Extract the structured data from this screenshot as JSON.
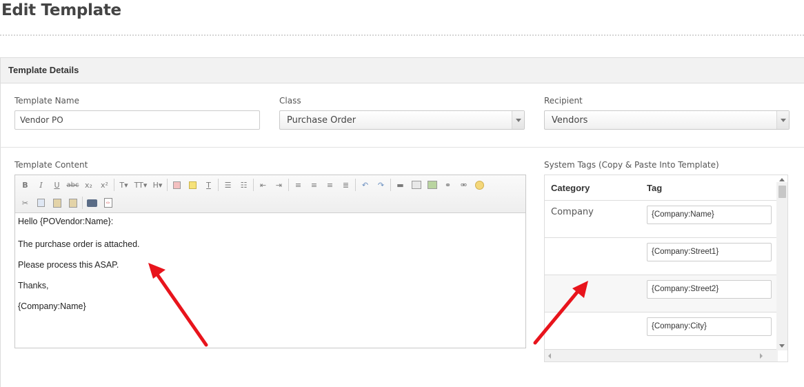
{
  "page": {
    "title": "Edit Template"
  },
  "panel": {
    "header": "Template Details"
  },
  "fields": {
    "template_name": {
      "label": "Template Name",
      "value": "Vendor PO"
    },
    "class": {
      "label": "Class",
      "value": "Purchase Order"
    },
    "recipient": {
      "label": "Recipient",
      "value": "Vendors"
    }
  },
  "editor": {
    "label": "Template Content",
    "toolbar": {
      "row1": [
        "B",
        "I",
        "U",
        "abc",
        "x₂",
        "x²",
        "T▾",
        "TT▾",
        "H▾"
      ],
      "icons": [
        "bold-icon",
        "italic-icon",
        "underline-icon",
        "strikethrough-icon",
        "subscript-icon",
        "superscript-icon",
        "font-icon",
        "font-size-icon",
        "heading-icon",
        "clear-format-icon",
        "highlight-icon",
        "remove-format-icon",
        "bullet-list-icon",
        "numbered-list-icon",
        "outdent-icon",
        "indent-icon",
        "align-left-icon",
        "align-center-icon",
        "align-right-icon",
        "justify-icon",
        "undo-icon",
        "redo-icon",
        "horizontal-rule-icon",
        "table-icon",
        "image-icon",
        "link-icon",
        "unlink-icon",
        "emoji-icon",
        "cut-icon",
        "copy-icon",
        "paste-icon",
        "paste-text-icon",
        "print-icon",
        "source-icon"
      ]
    },
    "content": [
      "Hello {POVendor:Name}:",
      "The purchase order is attached.",
      "Please process this ASAP.",
      "Thanks,",
      "{Company:Name}"
    ]
  },
  "tags": {
    "label": "System Tags (Copy & Paste Into Template)",
    "headers": {
      "category": "Category",
      "tag": "Tag"
    },
    "rows": [
      {
        "category": "Company",
        "tag": "{Company:Name}"
      },
      {
        "category": "",
        "tag": "{Company:Street1}"
      },
      {
        "category": "",
        "tag": "{Company:Street2}"
      },
      {
        "category": "",
        "tag": "{Company:City}"
      }
    ]
  },
  "colors": {
    "annotation_arrow": "#e8141c",
    "panel_header_bg": "#f2f2f2"
  }
}
